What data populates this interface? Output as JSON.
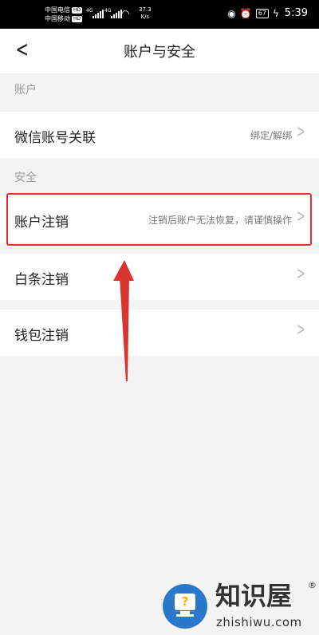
{
  "status_bar": {
    "carrier_1": "中国电信",
    "carrier_2": "中国移动",
    "hd_badge": "HD",
    "signal_tag": "4G",
    "net_speed": "37.3",
    "net_speed_unit": "K/s",
    "battery": "67",
    "time": "5:39"
  },
  "nav": {
    "title": "账户与安全"
  },
  "sections": {
    "account": "账户",
    "security": "安全"
  },
  "rows": {
    "wechat": {
      "label": "微信账号关联",
      "value": "绑定/解绑"
    },
    "account_cancel": {
      "label": "账户注销",
      "value": "注销后账户无法恢复，请谨慎操作"
    },
    "baitiao_cancel": {
      "label": "白条注销"
    },
    "wallet_cancel": {
      "label": "钱包注销"
    }
  },
  "watermark": {
    "title": "知识屋",
    "url": "zhishiwu.com"
  },
  "colors": {
    "highlight": "#d9342e",
    "arrow": "#d9342e",
    "watermark_icon": "#2a78c9"
  }
}
